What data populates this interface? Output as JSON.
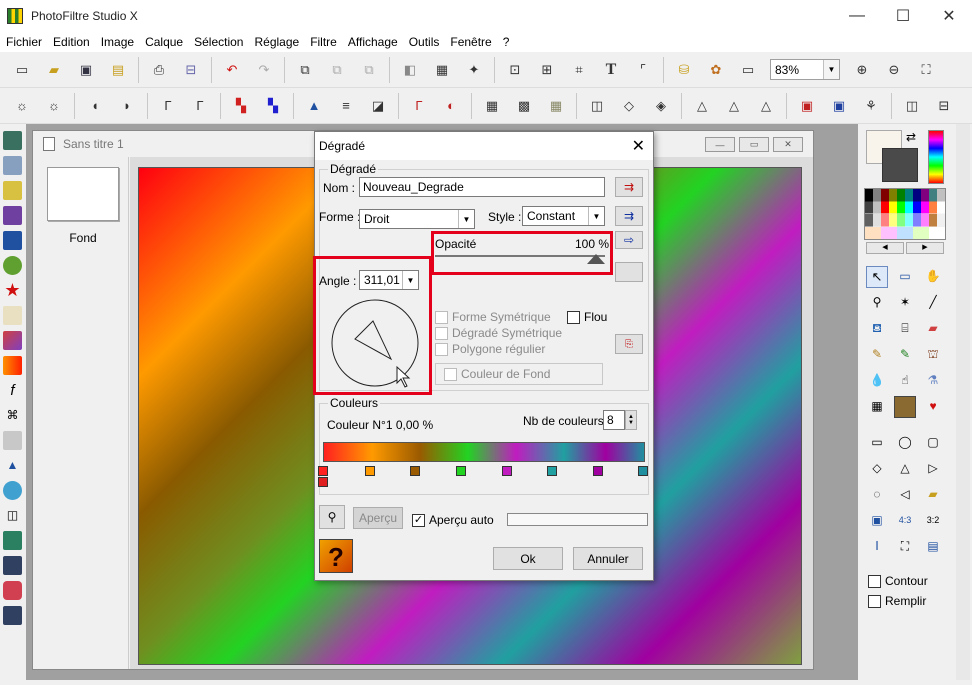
{
  "app": {
    "title": "PhotoFiltre Studio X"
  },
  "menu": [
    "Fichier",
    "Edition",
    "Image",
    "Calque",
    "Sélection",
    "Réglage",
    "Filtre",
    "Affichage",
    "Outils",
    "Fenêtre",
    "?"
  ],
  "toolbar": {
    "zoom": "83%"
  },
  "document": {
    "title": "Sans titre 1",
    "layer_label": "Fond"
  },
  "dialog": {
    "title": "Dégradé",
    "group_label": "Dégradé",
    "name_label": "Nom :",
    "name_value": "Nouveau_Degrade",
    "shape_label": "Forme :",
    "shape_value": "Droit",
    "style_label": "Style :",
    "style_value": "Constant",
    "opacity_label": "Opacité",
    "opacity_value": "100 %",
    "angle_label": "Angle :",
    "angle_value": "311,01",
    "symmetric_shape": "Forme Symétrique",
    "blur": "Flou",
    "symmetric_gradient": "Dégradé Symétrique",
    "regular_polygon": "Polygone régulier",
    "background_color": "Couleur de Fond",
    "colors_group": "Couleurs",
    "color_info": "Couleur N°1 0,00 %",
    "nb_colors_label": "Nb de couleurs :",
    "nb_colors_value": "8",
    "preview_button": "Aperçu",
    "auto_preview": "Aperçu auto",
    "ok": "Ok",
    "cancel": "Annuler",
    "stop_colors": [
      "#ff2020",
      "#ff9a00",
      "#9a5a00",
      "#22d322",
      "#c01cc0",
      "#20a0a0",
      "#a000a0",
      "#2090a0"
    ]
  },
  "right_panel": {
    "contour": "Contour",
    "fill": "Remplir"
  }
}
